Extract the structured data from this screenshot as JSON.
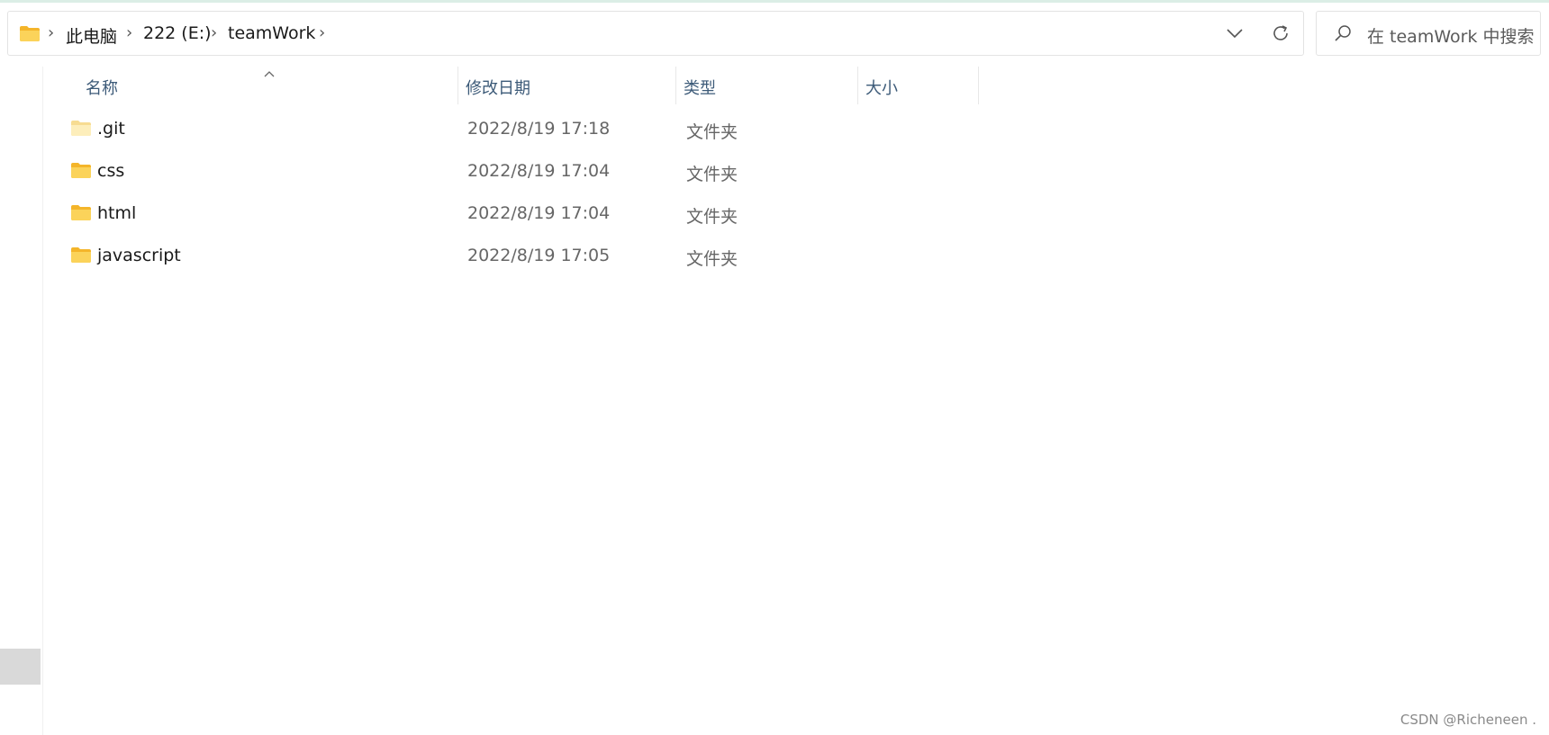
{
  "address_bar": {
    "breadcrumbs": [
      "此电脑",
      "222 (E:)",
      "teamWork"
    ]
  },
  "search": {
    "placeholder": "在 teamWork 中搜索"
  },
  "columns": [
    "名称",
    "修改日期",
    "类型",
    "大小"
  ],
  "files": [
    {
      "name": ".git",
      "modified": "2022/8/19 17:18",
      "type": "文件夹",
      "hidden": true
    },
    {
      "name": "css",
      "modified": "2022/8/19 17:04",
      "type": "文件夹",
      "hidden": false
    },
    {
      "name": "html",
      "modified": "2022/8/19 17:04",
      "type": "文件夹",
      "hidden": false
    },
    {
      "name": "javascript",
      "modified": "2022/8/19 17:05",
      "type": "文件夹",
      "hidden": false
    }
  ],
  "watermark": "CSDN @Richeneen .",
  "icons": {
    "folder": "folder-icon",
    "dropdown": "chevron-down-icon",
    "refresh": "refresh-icon",
    "search": "search-icon",
    "sort": "sort-ascending-icon"
  },
  "colors": {
    "folder_yellow": "#f8c840",
    "header_text": "#3c5a78"
  }
}
